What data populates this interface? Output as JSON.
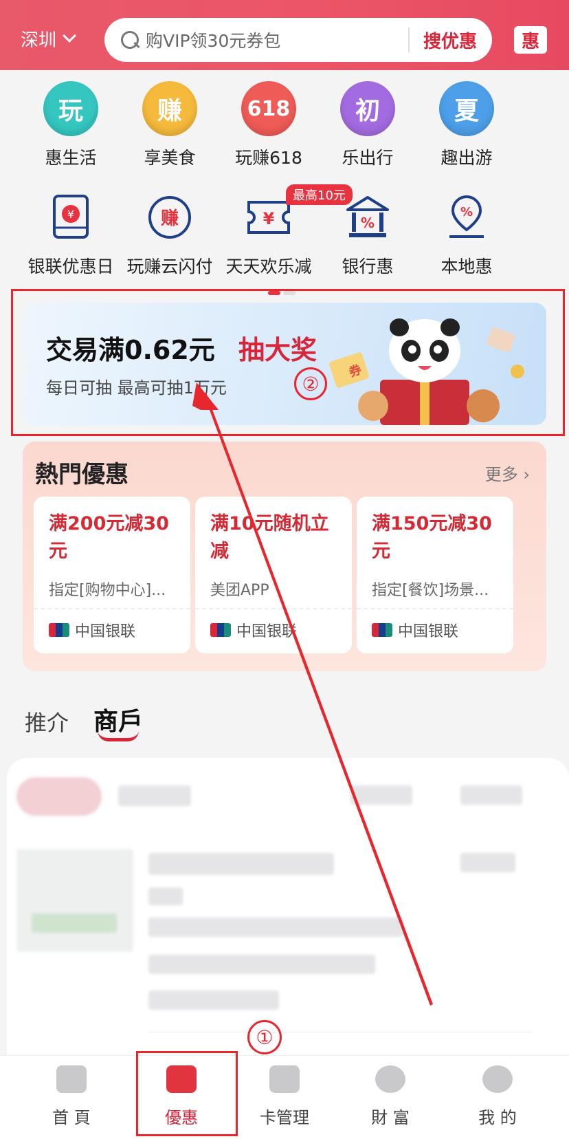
{
  "header": {
    "city": "深圳",
    "search_placeholder": "购VIP领30元券包",
    "search_button": "搜优惠",
    "hui_badge": "惠"
  },
  "quick_row1": [
    {
      "label": "惠生活",
      "glyph": "玩",
      "color": "#35c6c0"
    },
    {
      "label": "享美食",
      "glyph": "赚",
      "color": "#f5b93b"
    },
    {
      "label": "玩赚618",
      "glyph": "618",
      "color": "#ef5b57"
    },
    {
      "label": "乐出行",
      "glyph": "初",
      "color": "#a36be0"
    },
    {
      "label": "趣出游",
      "glyph": "夏",
      "color": "#4c9fe8"
    }
  ],
  "quick_row2": [
    {
      "label": "银联优惠日",
      "icon": "wallet-icon"
    },
    {
      "label": "玩赚云闪付",
      "icon": "earn-icon"
    },
    {
      "label": "天天欢乐减",
      "icon": "coupon-icon"
    },
    {
      "label": "银行惠",
      "icon": "bank-icon"
    },
    {
      "label": "本地惠",
      "icon": "location-icon"
    }
  ],
  "promo_tag": "最高10元",
  "banner": {
    "title": "交易满0.62元",
    "title_highlight": "抽大奖",
    "subtitle": "每日可抽  最高可抽1万元"
  },
  "hot_deals": {
    "title": "熱門優惠",
    "more": "更多",
    "cards": [
      {
        "title": "满200元减30元",
        "desc": "指定[购物中心]...",
        "issuer": "中国银联"
      },
      {
        "title": "满10元随机立减",
        "desc": "美团APP",
        "issuer": "中国银联"
      },
      {
        "title": "满150元减30元",
        "desc": "指定[餐饮]场景...",
        "issuer": "中国银联"
      }
    ]
  },
  "tabs": {
    "recommend": "推介",
    "merchant": "商戶"
  },
  "bottom_nav": [
    {
      "label": "首 頁",
      "active": false
    },
    {
      "label": "優惠",
      "active": true
    },
    {
      "label": "卡管理",
      "active": false
    },
    {
      "label": "財 富",
      "active": false
    },
    {
      "label": "我 的",
      "active": false
    }
  ],
  "annotations": {
    "marker_1": "①",
    "marker_2": "②"
  },
  "colors": {
    "brand_red": "#d8253a",
    "header_red": "#ec5567",
    "annotation_red": "#e8262d"
  }
}
